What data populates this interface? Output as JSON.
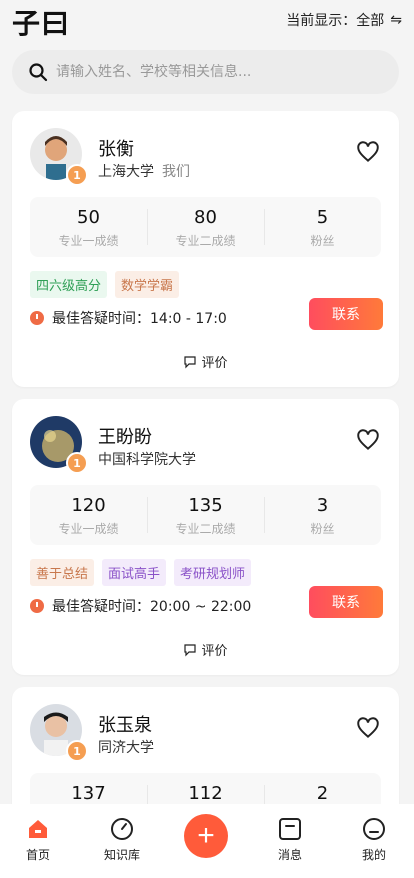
{
  "header": {
    "logo": "子曰",
    "filter_label": "当前显示：全部"
  },
  "search": {
    "placeholder": "请输入姓名、学校等相关信息..."
  },
  "cards": [
    {
      "name": "张衡",
      "school": "上海大学",
      "extra": "我们",
      "rank": "1",
      "stats": [
        {
          "value": "50",
          "label": "专业一成绩"
        },
        {
          "value": "80",
          "label": "专业二成绩"
        },
        {
          "value": "5",
          "label": "粉丝"
        }
      ],
      "tags": [
        "四六级高分",
        "数学学霸"
      ],
      "time": "最佳答疑时间：14:0 - 17:0",
      "contact": "联系",
      "review": "评价"
    },
    {
      "name": "王盼盼",
      "school": "中国科学院大学",
      "rank": "1",
      "stats": [
        {
          "value": "120",
          "label": "专业一成绩"
        },
        {
          "value": "135",
          "label": "专业二成绩"
        },
        {
          "value": "3",
          "label": "粉丝"
        }
      ],
      "tags": [
        "善于总结",
        "面试高手",
        "考研规划师"
      ],
      "time": "最佳答疑时间：20:00 ~ 22:00",
      "contact": "联系",
      "review": "评价"
    },
    {
      "name": "张玉泉",
      "school": "同济大学",
      "rank": "1",
      "stats": [
        {
          "value": "137"
        },
        {
          "value": "112"
        },
        {
          "value": "2"
        }
      ]
    }
  ],
  "nav": {
    "home": "首页",
    "knowledge": "知识库",
    "plus": "+",
    "messages": "消息",
    "mine": "我的"
  },
  "colors": {
    "accent": "#ff5b3a",
    "contact_start": "#ff4d5e",
    "contact_end": "#ff7a3a"
  }
}
